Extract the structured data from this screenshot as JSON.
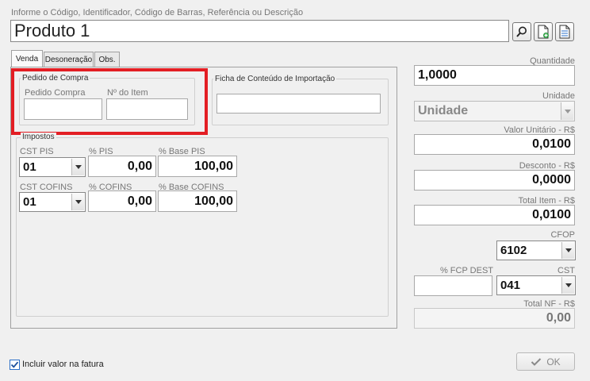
{
  "header": {
    "hint": "Informe o Código, Identificador, Código de Barras, Referência ou Descrição",
    "product": "Produto 1"
  },
  "toolbar": {
    "icons": [
      "search-icon",
      "add-document-icon",
      "document-icon"
    ]
  },
  "tabs": [
    {
      "label": "Venda",
      "active": true
    },
    {
      "label": "Desoneração",
      "active": false
    },
    {
      "label": "Obs.",
      "active": false
    }
  ],
  "pedido_compra": {
    "title": "Pedido de Compra",
    "pedido_label": "Pedido Compra",
    "pedido_value": "",
    "item_label": "Nº do Item",
    "item_value": ""
  },
  "ficha": {
    "title": "Ficha de Conteúdo de Importação",
    "value": ""
  },
  "impostos": {
    "title": "Impostos",
    "pis": {
      "cst_label": "CST PIS",
      "cst_value": "01",
      "pct_label": "% PIS",
      "pct_value": "0,00",
      "base_label": "% Base PIS",
      "base_value": "100,00"
    },
    "cofins": {
      "cst_label": "CST COFINS",
      "cst_value": "01",
      "pct_label": "% COFINS",
      "pct_value": "0,00",
      "base_label": "% Base COFINS",
      "base_value": "100,00"
    }
  },
  "right": {
    "quantidade_label": "Quantidade",
    "quantidade_value": "1,0000",
    "unidade_label": "Unidade",
    "unidade_value": "Unidade",
    "valor_unit_label": "Valor Unitário - R$",
    "valor_unit_value": "0,0100",
    "desconto_label": "Desconto - R$",
    "desconto_value": "0,0000",
    "total_item_label": "Total Item - R$",
    "total_item_value": "0,0100",
    "cfop_label": "CFOP",
    "cfop_value": "6102",
    "fcp_label": "% FCP DEST",
    "fcp_value": "",
    "cst_label": "CST",
    "cst_value": "041",
    "total_nf_label": "Total NF - R$",
    "total_nf_value": "0,00"
  },
  "footer": {
    "incluir_label": "Incluir valor na fatura",
    "incluir_checked": true,
    "ok_label": "OK"
  },
  "colors": {
    "highlight": "#e31e24",
    "ok_check": "#888888",
    "checkbox": "#2a6fc9"
  }
}
